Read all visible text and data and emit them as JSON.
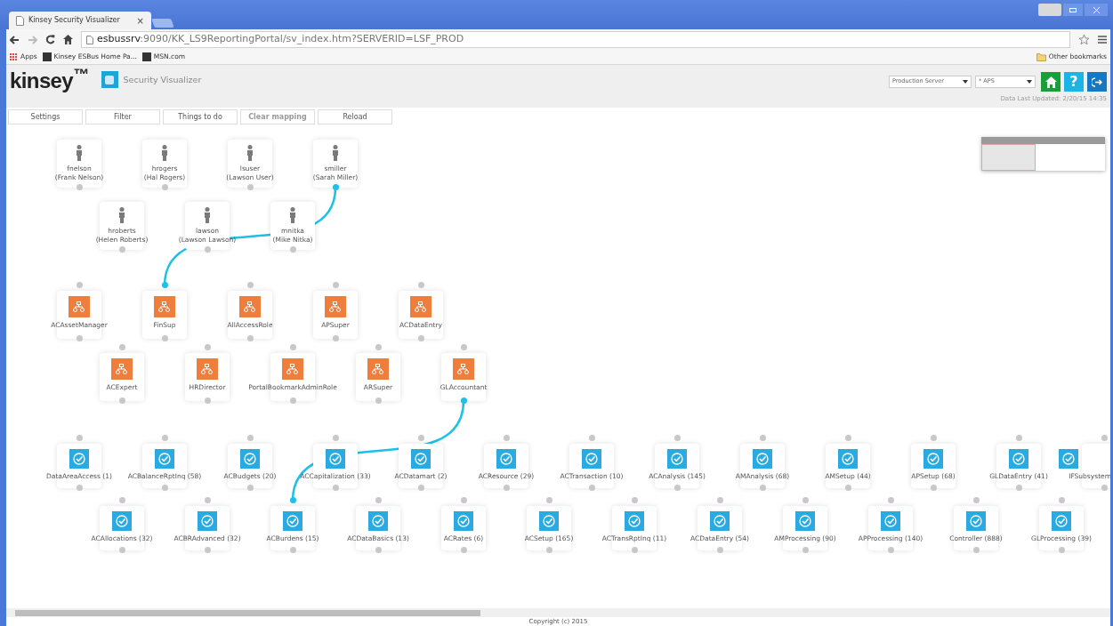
{
  "browser": {
    "tab": {
      "title": "Kinsey Security Visualizer",
      "close": "×"
    },
    "url_host": "esbussrv",
    "url_path": ":9090/KK_LS9ReportingPortal/sv_index.htm?SERVERID=LSF_PROD",
    "bookmarks": [
      "Apps",
      "Kinsey ESBus Home Pa...",
      "MSN.com"
    ],
    "other_bookmarks": "Other bookmarks"
  },
  "header": {
    "logo": "kinsey$^{™}$",
    "app_title": "Security Visualizer",
    "server_select": "Production Server",
    "company_select": "* APS",
    "help": "?",
    "data_updated": "Data Last Updated: 2/20/15 14:35"
  },
  "toolbar": [
    {
      "label": "Settings",
      "disabled": false
    },
    {
      "label": "Filter",
      "disabled": false
    },
    {
      "label": "Things to do",
      "disabled": false
    },
    {
      "label": "Clear mapping",
      "disabled": true
    },
    {
      "label": "Reload",
      "disabled": false
    }
  ],
  "users": [
    [
      {
        "name": "fnelson",
        "full": "(Frank Nelson)",
        "linked": false
      },
      {
        "name": "hrogers",
        "full": "(Hal Rogers)",
        "linked": false
      },
      {
        "name": "lsuser",
        "full": "(Lawson User)",
        "linked": false
      },
      {
        "name": "smiller",
        "full": "(Sarah Miller)",
        "linked": true
      }
    ],
    [
      {
        "name": "hroberts",
        "full": "(Helen Roberts)",
        "linked": false
      },
      {
        "name": "lawson",
        "full": "(Lawson Lawson)",
        "linked": false
      },
      {
        "name": "mnitka",
        "full": "(Mike Nitka)",
        "linked": false
      }
    ]
  ],
  "roles": [
    [
      {
        "name": "ACAssetManager",
        "from_user": false,
        "to_task": false
      },
      {
        "name": "FinSup",
        "from_user": true,
        "to_task": false
      },
      {
        "name": "AllAccessRole",
        "from_user": false,
        "to_task": false
      },
      {
        "name": "APSuper",
        "from_user": false,
        "to_task": false
      },
      {
        "name": "ACDataEntry",
        "from_user": false,
        "to_task": false
      }
    ],
    [
      {
        "name": "ACExpert",
        "from_user": false,
        "to_task": false
      },
      {
        "name": "HRDirector",
        "from_user": false,
        "to_task": false
      },
      {
        "name": "PortalBookmarkAdminRole",
        "from_user": false,
        "to_task": false
      },
      {
        "name": "ARSuper",
        "from_user": false,
        "to_task": false
      },
      {
        "name": "GLAccountant",
        "from_user": false,
        "to_task": true
      }
    ]
  ],
  "tasks": [
    [
      {
        "name": "DataAreaAccess (1)",
        "linked": false
      },
      {
        "name": "ACBalanceRptInq (58)",
        "linked": false
      },
      {
        "name": "ACBudgets (20)",
        "linked": false
      },
      {
        "name": "ACCapitalization (33)",
        "linked": false
      },
      {
        "name": "ACDatamart (2)",
        "linked": false
      },
      {
        "name": "ACResource (29)",
        "linked": false
      },
      {
        "name": "ACTransaction (10)",
        "linked": false
      },
      {
        "name": "ACAnalysis (145)",
        "linked": false
      },
      {
        "name": "AMAnalysis (68)",
        "linked": false
      },
      {
        "name": "AMSetup (44)",
        "linked": false
      },
      {
        "name": "APSetup (68)",
        "linked": false
      },
      {
        "name": "GLDataEntry (41)",
        "linked": false
      },
      {
        "name": "IFSubsystem",
        "linked": false
      }
    ],
    [
      {
        "name": "ACAllocations (32)",
        "linked": false
      },
      {
        "name": "ACBRAdvanced (32)",
        "linked": false
      },
      {
        "name": "ACBurdens (15)",
        "linked": true
      },
      {
        "name": "ACDataBasics (13)",
        "linked": false
      },
      {
        "name": "ACRates (6)",
        "linked": false
      },
      {
        "name": "ACSetup (165)",
        "linked": false
      },
      {
        "name": "ACTransRptInq (11)",
        "linked": false
      },
      {
        "name": "ACDataEntry (54)",
        "linked": false
      },
      {
        "name": "AMProcessing (90)",
        "linked": false
      },
      {
        "name": "APProcessing (140)",
        "linked": false
      },
      {
        "name": "Controller (888)",
        "linked": false
      },
      {
        "name": "GLProcessing (39)",
        "linked": false
      }
    ]
  ],
  "footer": "Copyright (c) 2015"
}
